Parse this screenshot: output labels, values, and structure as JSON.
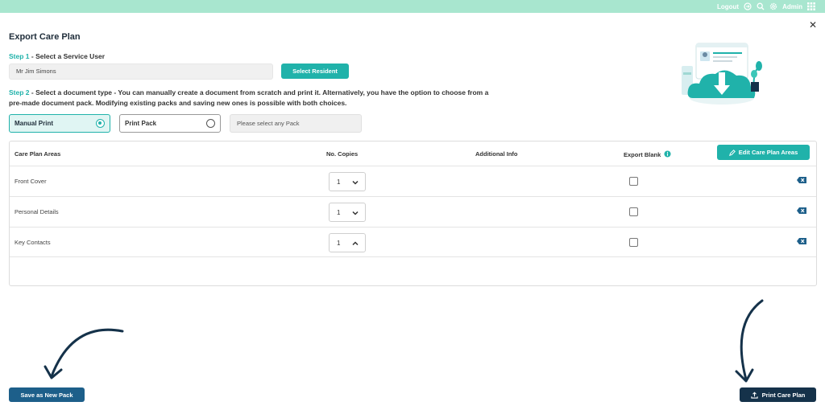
{
  "topbar": {
    "logout_label": "Logout",
    "admin_label": "Admin"
  },
  "page": {
    "title": "Export Care Plan"
  },
  "step1": {
    "number": "Step 1",
    "text": "- Select a Service User",
    "service_user_value": "Mr Jim Simons",
    "select_button": "Select Resident"
  },
  "step2": {
    "number": "Step 2",
    "text": "- Select a document type - You can manually create a document from scratch and print it. Alternatively, you have the option to choose from a pre-made document pack. Modifying existing packs and saving new ones is possible with both choices.",
    "options": [
      {
        "label": "Manual Print",
        "selected": true
      },
      {
        "label": "Print Pack",
        "selected": false
      }
    ],
    "pack_placeholder": "Please select any Pack"
  },
  "table": {
    "headers": {
      "areas": "Care Plan Areas",
      "copies": "No. Copies",
      "info": "Additional Info",
      "blank": "Export Blank"
    },
    "edit_button": "Edit Care Plan Areas",
    "rows": [
      {
        "name": "Front Cover",
        "copies": "1",
        "chevron": "down",
        "export_blank": false
      },
      {
        "name": "Personal Details",
        "copies": "1",
        "chevron": "down",
        "export_blank": false
      },
      {
        "name": "Key Contacts",
        "copies": "1",
        "chevron": "up",
        "export_blank": false
      }
    ]
  },
  "footer": {
    "save_pack": "Save as New Pack",
    "print_plan": "Print Care Plan"
  },
  "colors": {
    "accent": "#20b2aa",
    "topbar": "#a8e6cf",
    "navy": "#1d5f8a",
    "dark": "#15324a"
  },
  "icons": [
    "logout-icon",
    "search-icon",
    "gear-icon",
    "apps-grid-icon",
    "close-icon",
    "info-icon",
    "pencil-icon",
    "chevron-down-icon",
    "chevron-up-icon",
    "delete-icon",
    "upload-icon"
  ]
}
